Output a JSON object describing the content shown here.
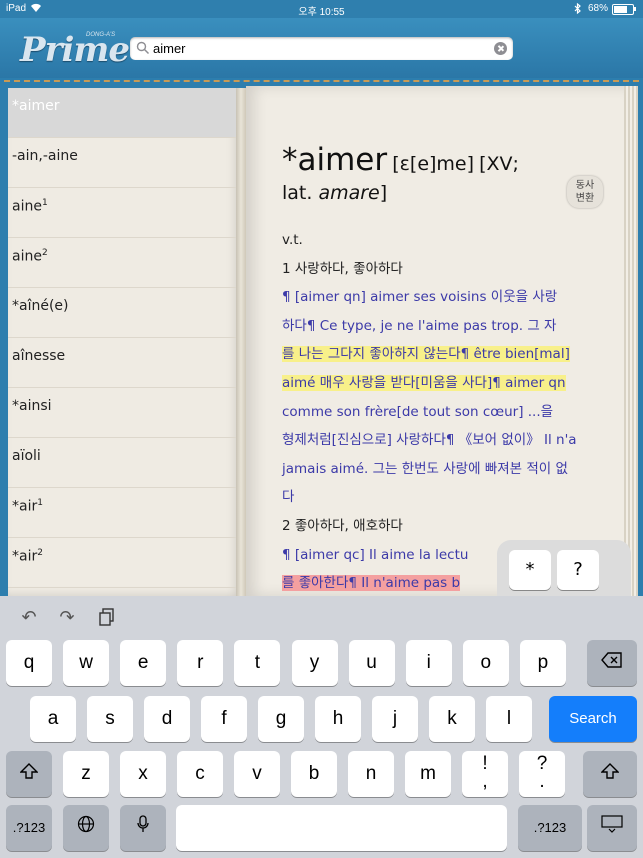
{
  "status_bar": {
    "device": "iPad",
    "time": "오후 10:55",
    "battery": "68%",
    "battery_level": 0.68
  },
  "header": {
    "logo_text": "Prime",
    "logo_sub": "DONG-A'S"
  },
  "search": {
    "value": "aimer"
  },
  "word_list": [
    {
      "text": "*aimer",
      "sup": "",
      "selected": true
    },
    {
      "text": "-ain,-aine",
      "sup": ""
    },
    {
      "text": "aine",
      "sup": "1"
    },
    {
      "text": "aine",
      "sup": "2"
    },
    {
      "text": "*aîné(e)",
      "sup": ""
    },
    {
      "text": "aînesse",
      "sup": ""
    },
    {
      "text": "*ainsi",
      "sup": ""
    },
    {
      "text": "aïoli",
      "sup": ""
    },
    {
      "text": "*air",
      "sup": "1"
    },
    {
      "text": "*air",
      "sup": "2"
    }
  ],
  "entry": {
    "headword": "*aimer",
    "pron": "[ɛ[e]me]",
    "etym_a": "[XV;",
    "etym_b": "lat. ",
    "etym_c": "amare",
    "etym_d": "]",
    "conj_button": [
      "동사",
      "변환"
    ],
    "pos": "v.t.",
    "sense1": "1 사랑하다, 좋아하다",
    "lines": [
      "¶ [aimer qn] aimer ses voisins 이웃을 사랑",
      "하다¶ Ce type, je ne l'aime pas trop. 그 자",
      "를 나는 그다지 좋아하지 않는다¶ être bien[mal]",
      "aimé 매우 사랑을 받다[미움을 사다]¶ aimer qn",
      "comme son frère[de tout son cœur] ...을",
      "형제처럼[진심으로] 사랑하다¶ 《보어 없이》 Il n'a",
      "jamais aimé. 그는 한번도 사랑에 빠져본 적이 없",
      "다"
    ],
    "sense2": "2 좋아하다, 애호하다",
    "lines2": [
      "¶ [aimer qc] Il aime la lectu",
      "를 좋아한다¶ Il n'aime pas b"
    ]
  },
  "symbol_keys": [
    "*",
    "?"
  ],
  "keyboard": {
    "row1": [
      "q",
      "w",
      "e",
      "r",
      "t",
      "y",
      "u",
      "i",
      "o",
      "p"
    ],
    "row2": [
      "a",
      "s",
      "d",
      "f",
      "g",
      "h",
      "j",
      "k",
      "l"
    ],
    "row3": [
      "z",
      "x",
      "c",
      "v",
      "b",
      "n",
      "m"
    ],
    "row3_punct": [
      [
        "!",
        ","
      ],
      [
        "?",
        "."
      ]
    ],
    "search_label": "Search",
    "num_label": ".?123"
  },
  "colors": {
    "leather_blue": "#2f7fae",
    "example_text": "#3c3aa8",
    "highlight_yellow": "#f8f08a",
    "highlight_red": "#f4a0a0",
    "search_key": "#147efb"
  }
}
